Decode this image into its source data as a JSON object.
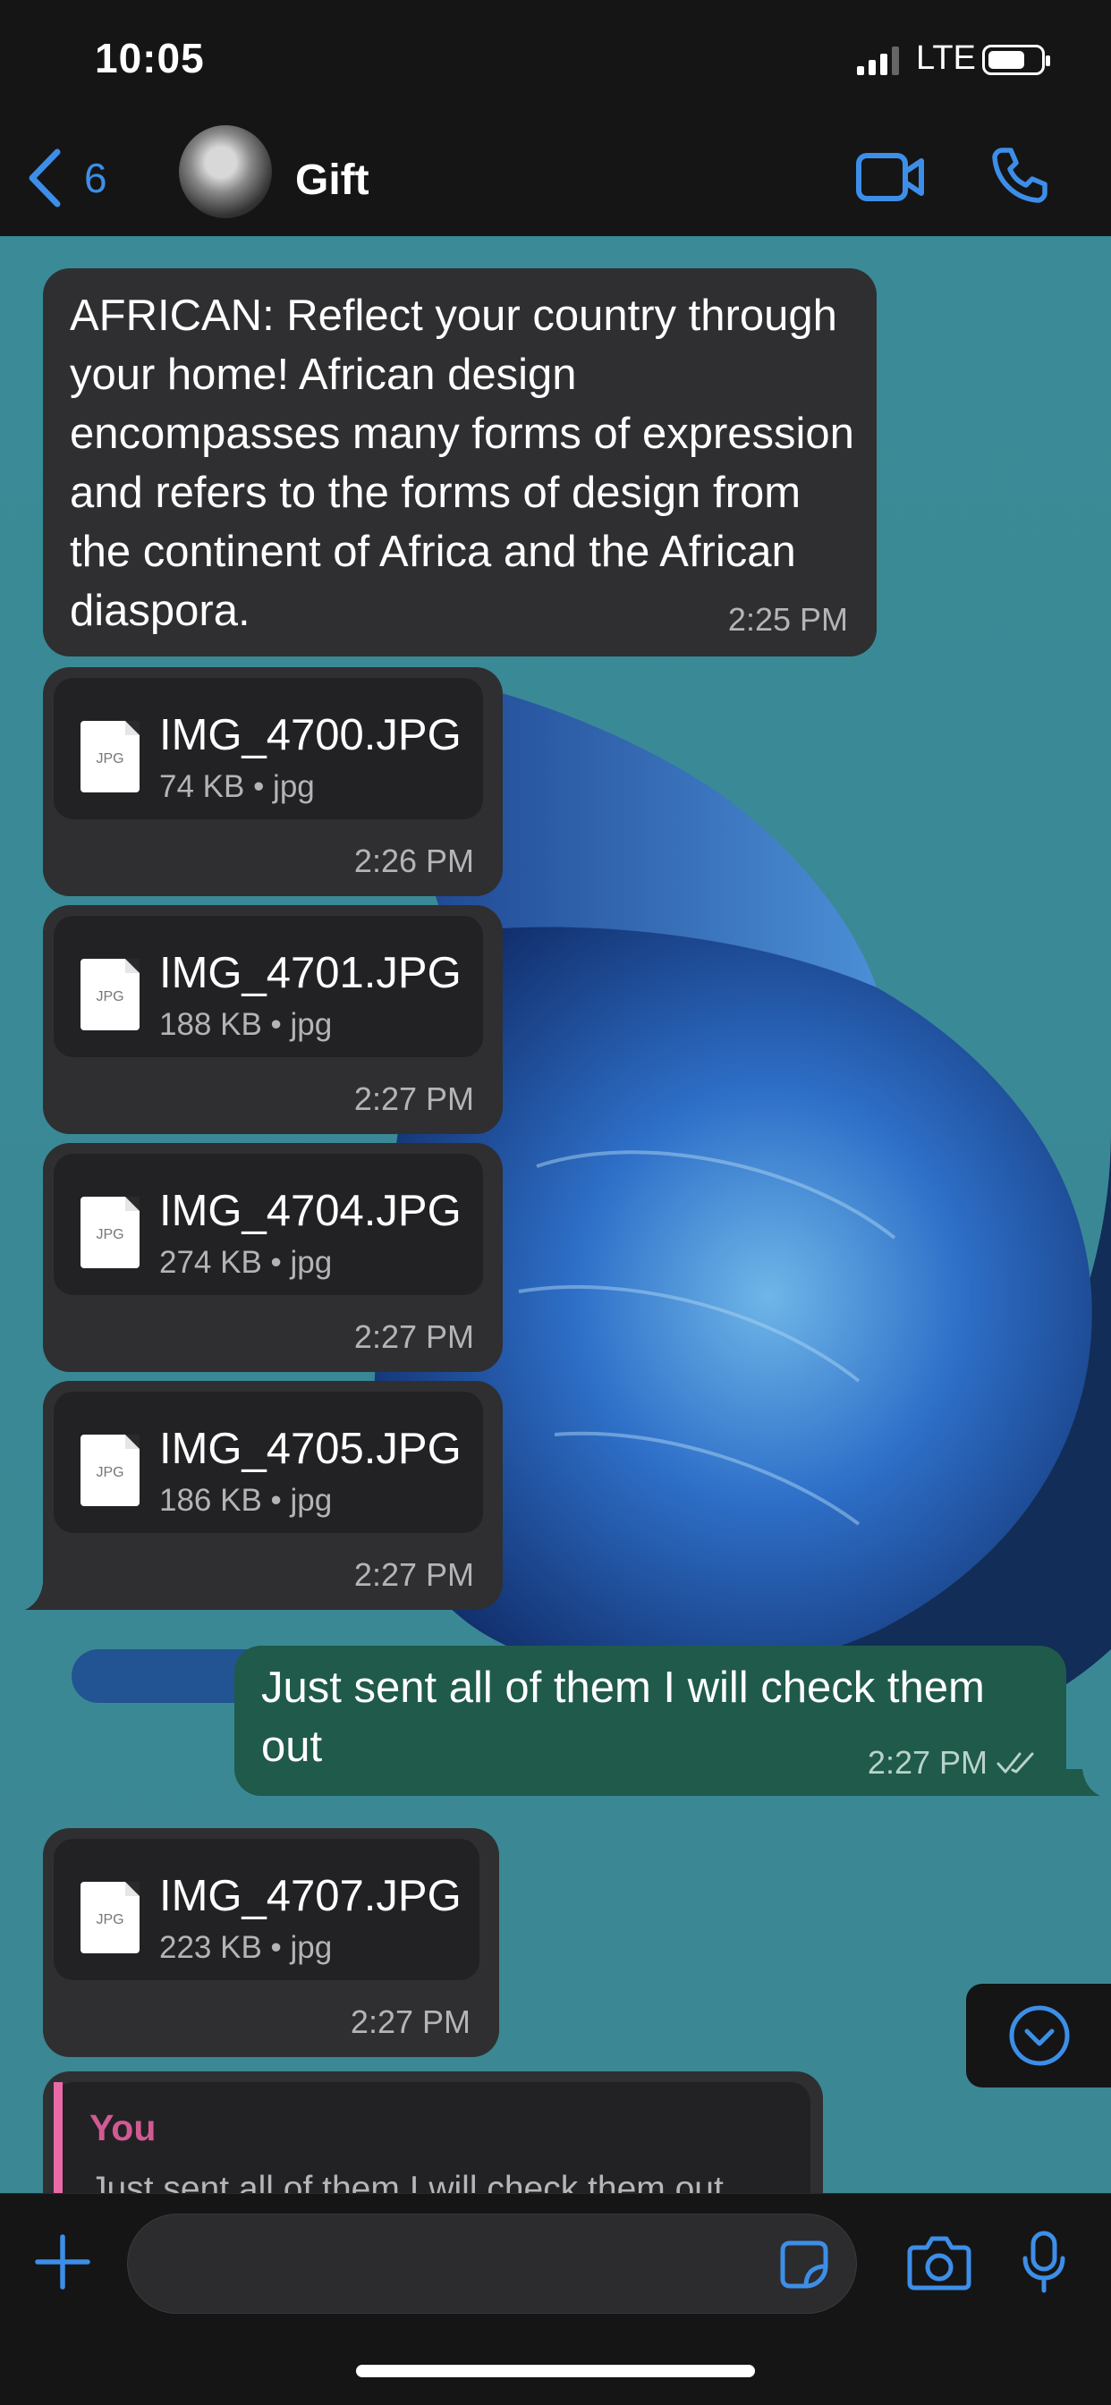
{
  "status": {
    "time": "10:05",
    "network": "LTE"
  },
  "header": {
    "unread_count": "6",
    "contact_name": "Gift"
  },
  "messages": [
    {
      "type": "text",
      "direction": "in",
      "text": "AFRICAN: Reflect your country through your home! African design encompasses many forms of expression and refers to the forms of design from the continent of Africa and the African diaspora.",
      "time": "2:25 PM"
    },
    {
      "type": "file",
      "direction": "in",
      "name": "IMG_4700.JPG",
      "size": "74 KB • jpg",
      "time": "2:26 PM",
      "icon_label": "JPG"
    },
    {
      "type": "file",
      "direction": "in",
      "name": "IMG_4701.JPG",
      "size": "188 KB • jpg",
      "time": "2:27 PM",
      "icon_label": "JPG"
    },
    {
      "type": "file",
      "direction": "in",
      "name": "IMG_4704.JPG",
      "size": "274 KB • jpg",
      "time": "2:27 PM",
      "icon_label": "JPG"
    },
    {
      "type": "file",
      "direction": "in",
      "name": "IMG_4705.JPG",
      "size": "186 KB • jpg",
      "time": "2:27 PM",
      "icon_label": "JPG"
    },
    {
      "type": "text",
      "direction": "out",
      "line1": "Just sent all of them I will check them",
      "line2": "out",
      "time": "2:27 PM"
    },
    {
      "type": "file",
      "direction": "in",
      "name": "IMG_4707.JPG",
      "size": "223 KB • jpg",
      "time": "2:27 PM",
      "icon_label": "JPG"
    },
    {
      "type": "reply",
      "direction": "in",
      "quote_author": "You",
      "quote_text": "Just sent all of them I will check them out"
    }
  ],
  "colors": {
    "accent": "#3d8ee8",
    "incoming_bubble": "#2f2f31",
    "outgoing_bubble": "#1f5a4a",
    "quote_author": "#d15a93",
    "wallpaper": "#3a8694"
  },
  "icons": {
    "back": "chevron-left-icon",
    "video": "video-camera-icon",
    "call": "phone-icon",
    "add": "plus-icon",
    "sticker": "sticker-icon",
    "camera": "camera-icon",
    "mic": "microphone-icon",
    "scroll_down": "chevron-down-circle-icon",
    "read_receipt": "double-check-icon"
  }
}
